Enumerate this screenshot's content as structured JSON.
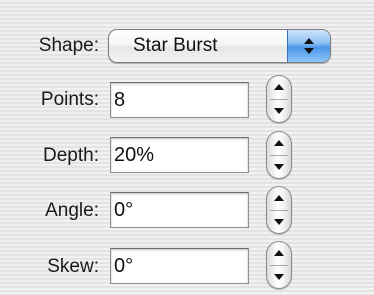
{
  "shape": {
    "label": "Shape:",
    "selected": "Star Burst"
  },
  "rows": [
    {
      "label": "Points:",
      "value": "8"
    },
    {
      "label": "Depth:",
      "value": "20%"
    },
    {
      "label": "Angle:",
      "value": "0°"
    },
    {
      "label": "Skew:",
      "value": "0°"
    }
  ],
  "colors": {
    "popup_accent": "#4c95e6"
  },
  "icons": {
    "popup": "up-down-arrows-icon",
    "stepper_up": "stepper-up-arrow-icon",
    "stepper_down": "stepper-down-arrow-icon"
  }
}
